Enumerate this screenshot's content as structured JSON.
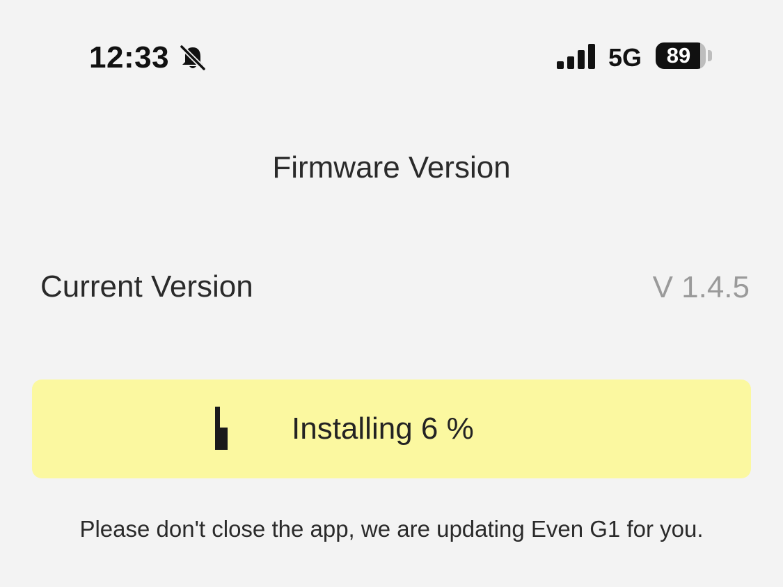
{
  "status_bar": {
    "time": "12:33",
    "silent_icon": "bell-slash-icon",
    "signal_icon": "cellular-signal-icon",
    "network": "5G",
    "battery_level": "89"
  },
  "header": {
    "title": "Firmware Version"
  },
  "current_version": {
    "label": "Current Version",
    "value": "V 1.4.5"
  },
  "install": {
    "text": "Installing 6 %",
    "progress_percent": 6,
    "background_color": "#fbf8a0"
  },
  "notice": {
    "text": "Please don't close the app, we are updating Even G1 for you."
  }
}
